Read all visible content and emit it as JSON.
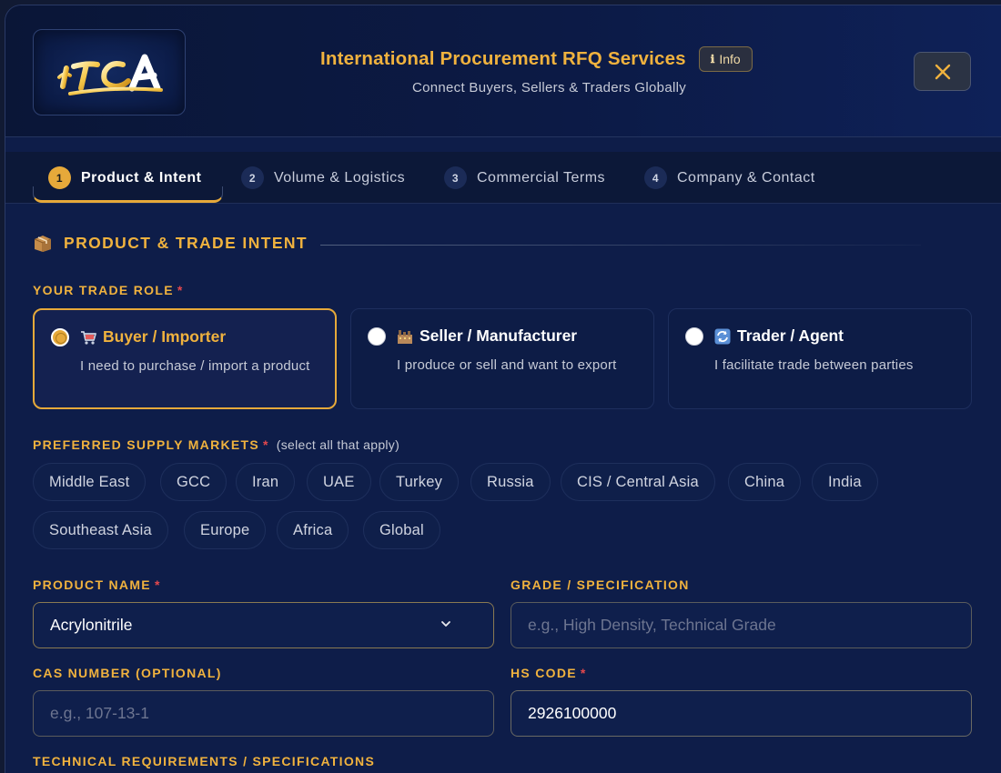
{
  "header": {
    "logo_text": "ITCA",
    "title": "International Procurement RFQ Services",
    "info_label": "Info",
    "subtitle": "Connect Buyers, Sellers & Traders Globally",
    "close_icon": "close-icon"
  },
  "tabs": [
    {
      "num": "1",
      "label": "Product & Intent",
      "active": true
    },
    {
      "num": "2",
      "label": "Volume & Logistics",
      "active": false
    },
    {
      "num": "3",
      "label": "Commercial Terms",
      "active": false
    },
    {
      "num": "4",
      "label": "Company & Contact",
      "active": false
    }
  ],
  "section": {
    "icon": "package-icon",
    "title": "PRODUCT & TRADE INTENT"
  },
  "trade_role": {
    "label": "YOUR TRADE ROLE",
    "required_mark": "*",
    "options": [
      {
        "icon": "cart-icon",
        "title": "Buyer / Importer",
        "desc": "I need to purchase / import a product",
        "selected": true
      },
      {
        "icon": "factory-icon",
        "title": "Seller / Manufacturer",
        "desc": "I produce or sell and want to export",
        "selected": false
      },
      {
        "icon": "refresh-icon",
        "title": "Trader / Agent",
        "desc": "I facilitate trade between parties",
        "selected": false
      }
    ]
  },
  "markets": {
    "label": "PREFERRED SUPPLY MARKETS",
    "required_mark": "*",
    "hint": "(select all that apply)",
    "items": [
      "Middle East",
      "GCC",
      "Iran",
      "UAE",
      "Turkey",
      "Russia",
      "CIS / Central Asia",
      "China",
      "India",
      "Southeast Asia",
      "Europe",
      "Africa",
      "Global"
    ]
  },
  "product_name": {
    "label": "PRODUCT NAME",
    "required_mark": "*",
    "value": "Acrylonitrile"
  },
  "grade": {
    "label": "GRADE / SPECIFICATION",
    "placeholder": "e.g., High Density, Technical Grade"
  },
  "cas": {
    "label": "CAS NUMBER (OPTIONAL)",
    "placeholder": "e.g., 107-13-1"
  },
  "hs_code": {
    "label": "HS CODE",
    "required_mark": "*",
    "value": "2926100000"
  },
  "tech_req": {
    "label": "TECHNICAL REQUIREMENTS / SPECIFICATIONS"
  },
  "colors": {
    "accent": "#f0b23e",
    "background": "#0e1d49",
    "required": "#e4484d"
  }
}
